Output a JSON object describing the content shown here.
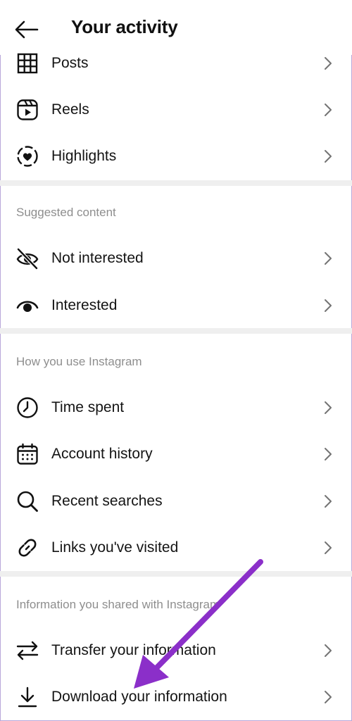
{
  "header": {
    "title": "Your activity"
  },
  "group1": {
    "items": [
      {
        "label": "Posts",
        "icon": "grid-icon"
      },
      {
        "label": "Reels",
        "icon": "reels-icon"
      },
      {
        "label": "Highlights",
        "icon": "highlights-icon"
      }
    ]
  },
  "suggested": {
    "title": "Suggested content",
    "items": [
      {
        "label": "Not interested",
        "icon": "eye-off-icon"
      },
      {
        "label": "Interested",
        "icon": "eye-icon"
      }
    ]
  },
  "usage": {
    "title": "How you use Instagram",
    "items": [
      {
        "label": "Time spent",
        "icon": "clock-icon"
      },
      {
        "label": "Account history",
        "icon": "calendar-icon"
      },
      {
        "label": "Recent searches",
        "icon": "search-icon"
      },
      {
        "label": "Links you've visited",
        "icon": "link-icon"
      }
    ]
  },
  "shared": {
    "title": "Information you shared with Instagram",
    "items": [
      {
        "label": "Transfer your information",
        "icon": "transfer-icon"
      },
      {
        "label": "Download your information",
        "icon": "download-icon"
      }
    ]
  },
  "colors": {
    "annotation_arrow": "#8b2fc9",
    "divider": "#efefef",
    "section_text": "#8e8e8e"
  }
}
